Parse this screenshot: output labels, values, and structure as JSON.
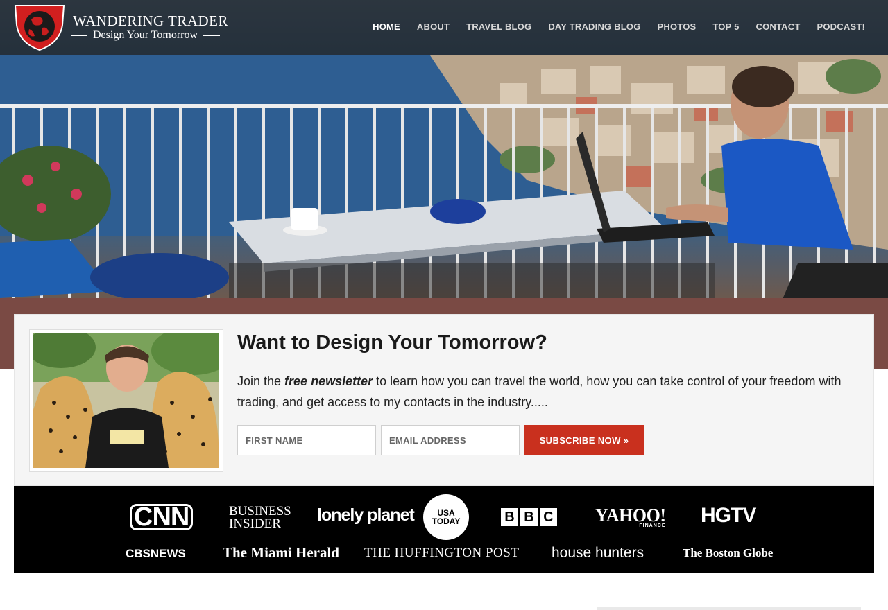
{
  "header": {
    "brand_title": "WANDERING TRADER",
    "brand_subtitle": "Design Your Tomorrow",
    "nav": [
      {
        "label": "HOME",
        "active": true
      },
      {
        "label": "ABOUT",
        "active": false
      },
      {
        "label": "TRAVEL BLOG",
        "active": false
      },
      {
        "label": "DAY TRADING BLOG",
        "active": false
      },
      {
        "label": "PHOTOS",
        "active": false
      },
      {
        "label": "TOP 5",
        "active": false
      },
      {
        "label": "CONTACT",
        "active": false
      },
      {
        "label": "PODCAST!",
        "active": false
      }
    ]
  },
  "optin": {
    "title": "Want to Design Your Tomorrow?",
    "text_before": "Join the ",
    "text_emphasis": "free newsletter",
    "text_after": " to learn how you can travel the world, how you can take control of your freedom with trading, and get access to my contacts in the industry.....",
    "first_name_placeholder": "FIRST NAME",
    "email_placeholder": "EMAIL ADDRESS",
    "subscribe_label": "SUBSCRIBE NOW »"
  },
  "press": {
    "cnn": "CNN",
    "business_insider_line1": "BUSINESS",
    "business_insider_line2": "INSIDER",
    "lonely_planet": "lonely planet",
    "usa_today_line1": "USA",
    "usa_today_line2": "TODAY",
    "bbc": [
      "B",
      "B",
      "C"
    ],
    "yahoo": "YAHOO!",
    "yahoo_sub": "FINANCE",
    "hgtv": "HGTV",
    "cbs_news": "CBSNEWS",
    "miami_herald": "The Miami Herald",
    "huffington_post": "THE HUFFINGTON POST",
    "house_hunters": "house hunters",
    "boston_globe": "The Boston Globe"
  },
  "colors": {
    "accent": "#c9301e",
    "nav_bg": "#141414",
    "press_bg": "#000000",
    "optin_bg": "#f5f5f5"
  },
  "icons": {
    "logo": "shield-globe-icon"
  }
}
